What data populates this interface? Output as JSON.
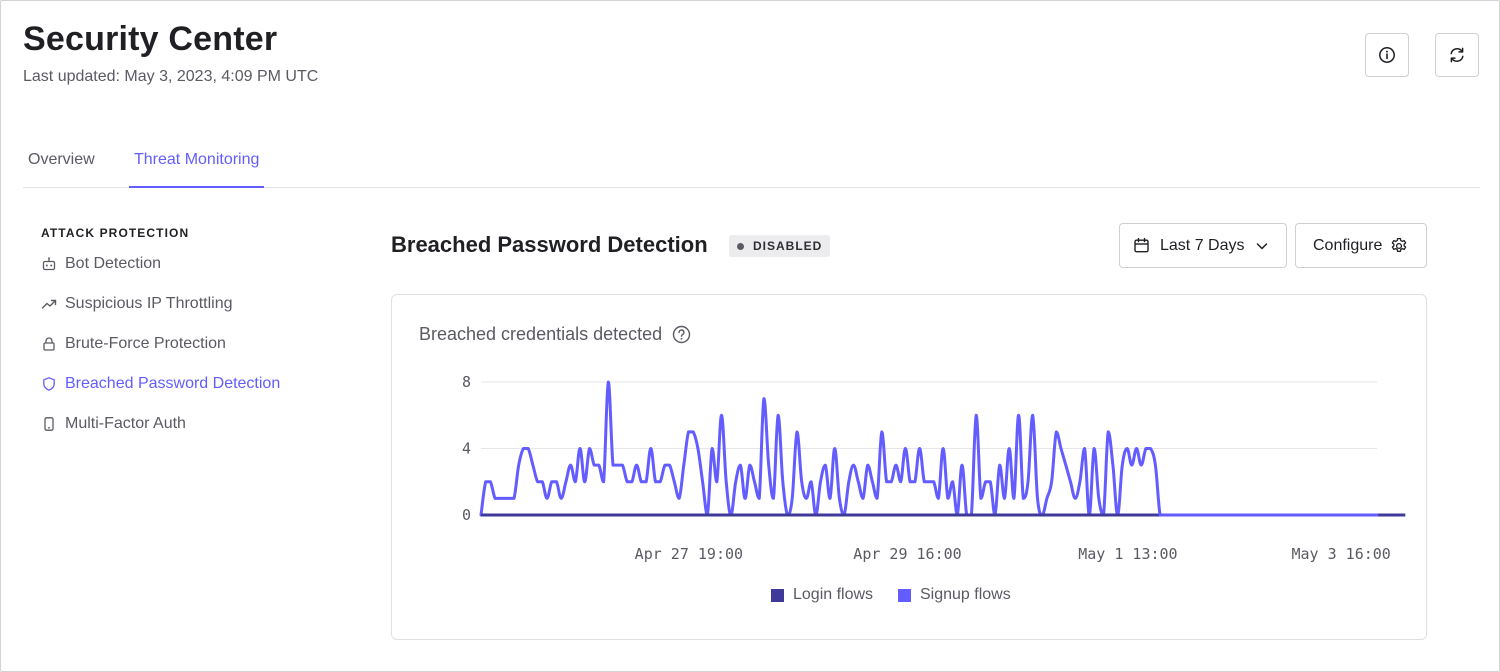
{
  "header": {
    "title": "Security Center",
    "last_updated": "Last updated: May 3, 2023, 4:09 PM UTC",
    "info_icon": "info-icon",
    "refresh_icon": "refresh-icon"
  },
  "tabs": [
    {
      "label": "Overview",
      "active": false
    },
    {
      "label": "Threat Monitoring",
      "active": true
    }
  ],
  "sidebar": {
    "heading": "ATTACK PROTECTION",
    "items": [
      {
        "label": "Bot Detection",
        "icon": "robot-icon",
        "active": false
      },
      {
        "label": "Suspicious IP Throttling",
        "icon": "trending-up-icon",
        "active": false
      },
      {
        "label": "Brute-Force Protection",
        "icon": "lock-icon",
        "active": false
      },
      {
        "label": "Breached Password Detection",
        "icon": "shield-icon",
        "active": true
      },
      {
        "label": "Multi-Factor Auth",
        "icon": "phone-icon",
        "active": false
      }
    ]
  },
  "section": {
    "title": "Breached Password Detection",
    "status_badge": "DISABLED",
    "date_range": "Last 7 Days",
    "configure_label": "Configure"
  },
  "card": {
    "title": "Breached credentials detected"
  },
  "colors": {
    "accent": "#635dff",
    "login_series": "#3f3a99",
    "signup_series": "#635dff"
  },
  "chart_data": {
    "type": "line",
    "title": "Breached credentials detected",
    "ylim": [
      0,
      8
    ],
    "yticks": [
      0,
      4,
      8
    ],
    "xlim": [
      "Apr 26 06:00",
      "May 3 22:00"
    ],
    "xticks": [
      "Apr 27 19:00",
      "Apr 29 16:00",
      "May 1 13:00",
      "May 3 16:00"
    ],
    "grid": true,
    "legend": "bottom-center",
    "x_interval_hours": 2,
    "series": [
      {
        "name": "Login flows",
        "values": [
          0,
          0,
          0,
          0,
          0,
          0,
          0,
          0,
          0,
          0,
          0,
          0,
          0,
          0,
          0,
          0,
          0,
          0,
          0,
          0,
          0,
          0,
          0,
          0,
          0,
          0,
          0,
          0,
          0,
          0,
          0,
          0,
          0,
          0,
          0,
          0,
          0,
          0,
          0,
          0,
          0,
          0,
          0,
          0,
          0,
          0,
          0,
          0,
          0,
          0,
          0,
          0,
          0,
          0,
          0,
          0,
          0,
          0,
          0,
          0,
          0,
          0,
          0,
          0,
          0,
          0,
          0,
          0,
          0,
          0,
          0,
          0,
          0,
          0,
          0,
          0,
          0,
          0,
          0,
          0,
          0,
          0,
          0,
          0,
          0,
          0,
          0,
          0,
          0,
          0,
          0,
          0,
          0,
          0,
          0,
          0,
          0,
          0,
          0,
          0,
          0,
          0,
          0,
          0,
          0,
          0,
          0,
          0,
          0,
          0,
          0,
          0,
          0,
          0,
          0,
          0,
          0,
          0,
          0,
          0,
          0,
          0,
          0,
          0,
          0,
          0,
          0,
          0,
          0,
          0,
          0,
          0,
          0,
          0,
          0,
          0,
          0,
          0,
          0,
          0,
          0,
          0,
          0,
          0,
          0,
          0,
          0,
          0,
          0,
          0,
          0,
          0,
          0,
          0,
          0,
          0,
          0,
          0,
          0,
          0,
          0,
          0,
          0,
          0,
          0,
          0,
          0,
          0,
          0,
          0,
          0,
          0,
          0,
          0,
          0,
          0,
          0,
          0,
          0,
          0,
          0,
          0,
          0,
          0,
          0,
          0,
          0,
          0,
          0,
          0,
          0,
          0,
          0,
          0,
          0,
          0,
          0
        ]
      },
      {
        "name": "Signup flows",
        "values": [
          0,
          2,
          2,
          1,
          1,
          1,
          1,
          1,
          3,
          4,
          4,
          3,
          2,
          2,
          1,
          2,
          2,
          1,
          2,
          3,
          2,
          4,
          2,
          4,
          3,
          3,
          2,
          8,
          3,
          3,
          3,
          2,
          2,
          3,
          2,
          2,
          4,
          2,
          2,
          3,
          3,
          2,
          1,
          3,
          5,
          5,
          4,
          2,
          0,
          4,
          2,
          6,
          2,
          0,
          2,
          3,
          1,
          3,
          2,
          1,
          7,
          3,
          1,
          6,
          2,
          0,
          1,
          5,
          2,
          1,
          2,
          0,
          2,
          3,
          1,
          4,
          1,
          0,
          2,
          3,
          2,
          1,
          3,
          2,
          1,
          5,
          2,
          2,
          3,
          2,
          4,
          2,
          2,
          4,
          2,
          2,
          2,
          1,
          4,
          1,
          2,
          0,
          3,
          0,
          0,
          6,
          1,
          2,
          2,
          0,
          3,
          1,
          4,
          1,
          6,
          1,
          2,
          6,
          1,
          0,
          1,
          2,
          5,
          4,
          3,
          2,
          1,
          2,
          4,
          0,
          4,
          1,
          0,
          5,
          3,
          0,
          3,
          4,
          3,
          4,
          3,
          4,
          4,
          3,
          0,
          0,
          0,
          0,
          0,
          0,
          0,
          0,
          0,
          0,
          0,
          0,
          0,
          0,
          0,
          0,
          0,
          0,
          0,
          0,
          0,
          0,
          0,
          0,
          0,
          0,
          0,
          0,
          0,
          0,
          0,
          0,
          0,
          0,
          0,
          0,
          0,
          0,
          0,
          0,
          0,
          0,
          0,
          0,
          0,
          0,
          0
        ]
      }
    ]
  }
}
